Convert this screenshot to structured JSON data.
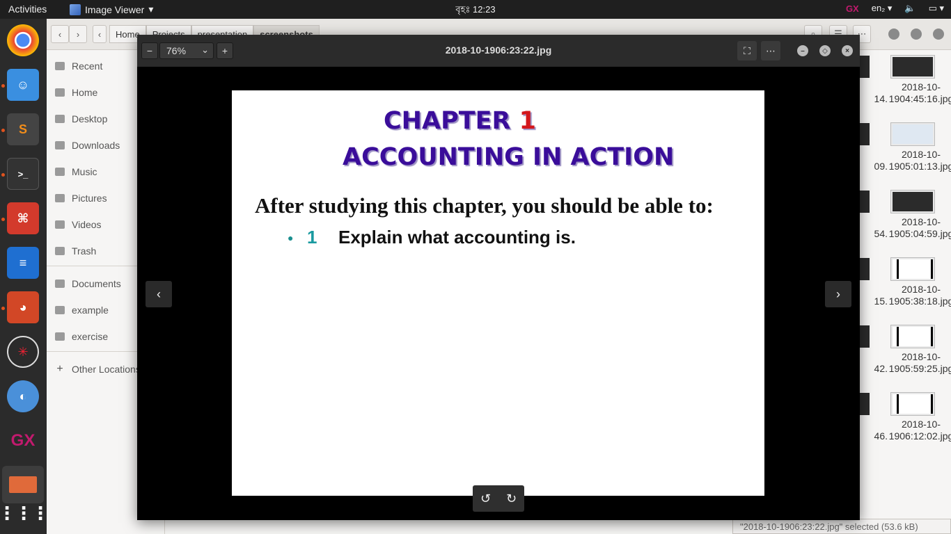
{
  "topbar": {
    "activities": "Activities",
    "app_name": "Image Viewer",
    "clock": "বৃহঃ 12:23",
    "gx": "GX",
    "lang": "en₂"
  },
  "files": {
    "breadcrumbs": [
      "Home",
      "Projects",
      "presentation",
      "screenshots"
    ],
    "sidebar": [
      "Recent",
      "Home",
      "Desktop",
      "Downloads",
      "Music",
      "Pictures",
      "Videos",
      "Trash",
      "Documents",
      "example",
      "exercise",
      "Other Locations"
    ],
    "thumbs": [
      {
        "label": "2018-10-1904:45:16.jpg",
        "left_cut": "14."
      },
      {
        "label": "2018-10-1905:01:13.jpg",
        "left_cut": "09."
      },
      {
        "label": "2018-10-1905:04:59.jpg",
        "left_cut": "54."
      },
      {
        "label": "2018-10-1905:38:18.jpg",
        "left_cut": "15."
      },
      {
        "label": "2018-10-1905:59:25.jpg",
        "left_cut": "42."
      },
      {
        "label": "2018-10-1906:12:02.jpg",
        "left_cut": "46."
      }
    ],
    "status": "\"2018-10-1906:23:22.jpg\" selected  (53.6 kB)"
  },
  "viewer": {
    "zoom": "76%",
    "filename": "2018-10-1906:23:22.jpg",
    "slide": {
      "chapter_label": "CHAPTER ",
      "chapter_number": "1",
      "subtitle": "ACCOUNTING IN ACTION",
      "intro": "After studying this chapter, you should be able to:",
      "bullet_number": "1",
      "bullet_text": "Explain what accounting is."
    }
  }
}
